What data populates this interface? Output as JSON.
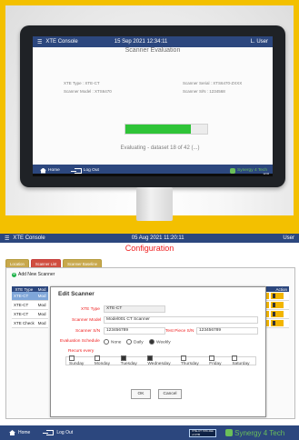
{
  "top": {
    "app_title": "XTE Console",
    "date": "15 Sep 2021 12:34:11",
    "user": "L. User",
    "screen_title": "Scanner Evaluation",
    "left_info": [
      "XTE Type : XTE-CT",
      "Scanner Model : XTS6470"
    ],
    "right_info": [
      "Scanner Serial : XTS6470-ZXXX",
      "Scanner S/N : 1234568"
    ],
    "progress_percent": 0.8,
    "status": "Evaluating - dataset 18 of 42 (...)",
    "footer_home": "Home",
    "footer_logout": "Log Out",
    "brand": "Synergy 4 Tech",
    "taskbar_right": "12:34"
  },
  "bottom": {
    "header": {
      "app_title": "XTE Console",
      "date": "05 Aug 2021 11:20:11",
      "user": "User"
    },
    "page_title": "Configuration",
    "tabs": [
      "Location",
      "Scanner List",
      "Scanner Baseline"
    ],
    "add_button": "Add New Scanner",
    "table": {
      "headers": [
        "XTE Type",
        "Mod"
      ],
      "rows": [
        [
          "XTE-CT",
          "Mod"
        ],
        [
          "XTE-CT",
          "Mod"
        ],
        [
          "XTE-CT",
          "Mod"
        ],
        [
          "XTE Check",
          "Mod"
        ]
      ],
      "right_headers": [
        "ule",
        "Action"
      ],
      "right_rows": [
        "",
        "",
        "kd",
        ""
      ]
    },
    "modal": {
      "title": "Edit Scanner",
      "xte_type_label": "XTE Type",
      "xte_type_value": "XTE-CT",
      "scanner_model_label": "Scanner Model",
      "scanner_model_value": "Model001 CT Scanner",
      "scanner_sn_label": "Scanner S/N",
      "scanner_sn_value": "123456789",
      "test_piece_label": "Test Piece S/N",
      "test_piece_value": "123456789",
      "eval_schedule_label": "Evaluation Schedule",
      "schedule_options": [
        "None",
        "Daily",
        "Weekly"
      ],
      "selected_schedule": "Weekly",
      "recurs_label": "Recurs every",
      "days": [
        "Sunday",
        "Monday",
        "Tuesday",
        "Wednesday",
        "Thursday",
        "Friday",
        "Saturday"
      ],
      "checked_days": [
        "Tuesday",
        "Wednesday"
      ],
      "ok": "OK",
      "cancel": "Cancel"
    },
    "footer": {
      "home": "Home",
      "logout": "Log Out",
      "disk_text": "XTE-CT 72% disk of 2TB",
      "brand": "Synergy 4 Tech"
    }
  }
}
